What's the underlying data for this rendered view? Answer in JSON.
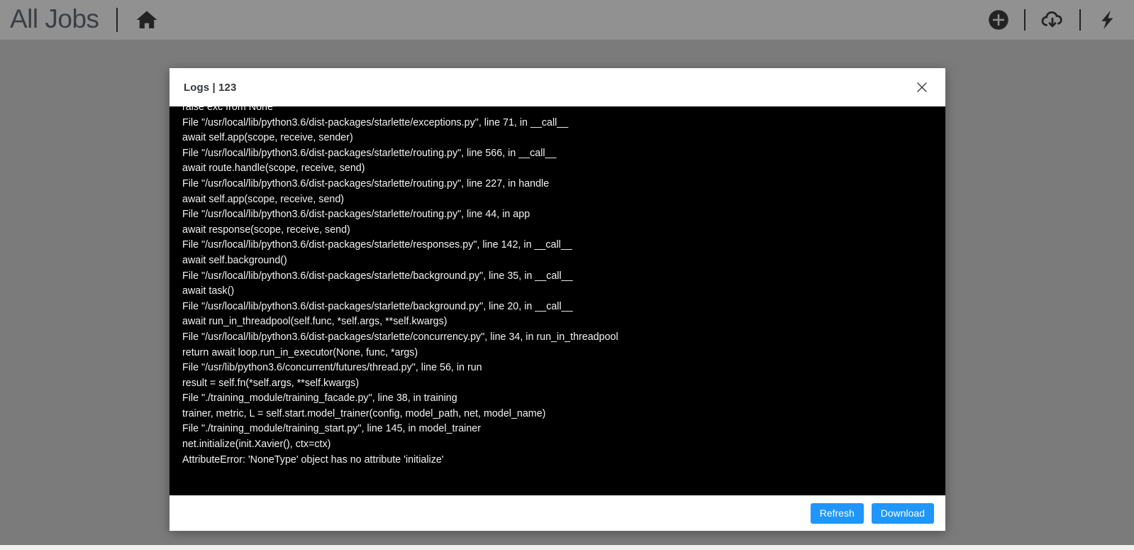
{
  "top_bar": {
    "brand_title": "All Jobs",
    "divider": "|",
    "icons": [
      {
        "name": "home-icon",
        "label": "Home"
      },
      {
        "name": "add-circle-icon",
        "label": "Add"
      },
      {
        "name": "cloud-download-icon",
        "label": "Download"
      },
      {
        "name": "lightning-bolt-icon",
        "label": "Quick Actions"
      }
    ]
  },
  "modal": {
    "title": "Logs | 123",
    "close_label": "✕",
    "footer": {
      "refresh_label": "Refresh",
      "download_label": "Download"
    },
    "log_lines": [
      "raise exc from None",
      "File \"/usr/local/lib/python3.6/dist-packages/starlette/exceptions.py\", line 71, in __call__",
      "await self.app(scope, receive, sender)",
      "File \"/usr/local/lib/python3.6/dist-packages/starlette/routing.py\", line 566, in __call__",
      "await route.handle(scope, receive, send)",
      "File \"/usr/local/lib/python3.6/dist-packages/starlette/routing.py\", line 227, in handle",
      "await self.app(scope, receive, send)",
      "File \"/usr/local/lib/python3.6/dist-packages/starlette/routing.py\", line 44, in app",
      "await response(scope, receive, send)",
      "File \"/usr/local/lib/python3.6/dist-packages/starlette/responses.py\", line 142, in __call__",
      "await self.background()",
      "File \"/usr/local/lib/python3.6/dist-packages/starlette/background.py\", line 35, in __call__",
      "await task()",
      "File \"/usr/local/lib/python3.6/dist-packages/starlette/background.py\", line 20, in __call__",
      "await run_in_threadpool(self.func, *self.args, **self.kwargs)",
      "File \"/usr/local/lib/python3.6/dist-packages/starlette/concurrency.py\", line 34, in run_in_threadpool",
      "return await loop.run_in_executor(None, func, *args)",
      "File \"/usr/lib/python3.6/concurrent/futures/thread.py\", line 56, in run",
      "result = self.fn(*self.args, **self.kwargs)",
      "File \"./training_module/training_facade.py\", line 38, in training",
      "trainer, metric, L = self.start.model_trainer(config, model_path, net, model_name)",
      "File \"./training_module/training_start.py\", line 145, in model_trainer",
      "net.initialize(init.Xavier(), ctx=ctx)",
      "AttributeError: 'NoneType' object has no attribute 'initialize'"
    ]
  },
  "colors": {
    "page_background": "#7b7b7b",
    "top_bar": "#919191",
    "accent_button": "#1f96fb",
    "console_background": "#000000",
    "console_text": "#f3f3f3"
  }
}
